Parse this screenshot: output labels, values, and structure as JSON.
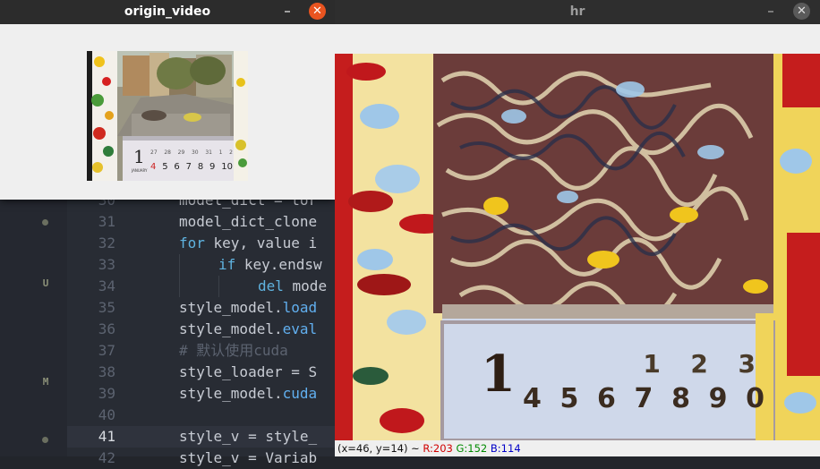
{
  "editor": {
    "lines": [
      {
        "num": "30",
        "code": "model_dict = tor"
      },
      {
        "num": "31",
        "code": "model_dict_clone"
      },
      {
        "num": "32",
        "code_kw": "for",
        "code_rest": " key, value i"
      },
      {
        "num": "33",
        "code_kw": "if",
        "code_rest": " key.endsw"
      },
      {
        "num": "34",
        "code_kw": "del",
        "code_rest": " mode"
      },
      {
        "num": "35",
        "code_pre": "style_model.",
        "code_fn": "load"
      },
      {
        "num": "36",
        "code_pre": "style_model.",
        "code_fn": "eval"
      },
      {
        "num": "37",
        "comment": "# 默认使用cuda"
      },
      {
        "num": "38",
        "code": "style_loader = S"
      },
      {
        "num": "39",
        "code_pre": "style_model.",
        "code_fn": "cuda"
      },
      {
        "num": "40",
        "code": ""
      },
      {
        "num": "41",
        "code": "style_v = style_"
      },
      {
        "num": "42",
        "code": "style_v = Variab"
      }
    ],
    "current_line": "41",
    "git_marks": [
      "U",
      "M"
    ]
  },
  "origin_window": {
    "title": "origin_video",
    "min_glyph": "–",
    "close_glyph": "✕",
    "calendar": {
      "month": "1",
      "month_name": "JANUARY",
      "row1": [
        "27",
        "28",
        "29",
        "30",
        "31",
        "1",
        "2"
      ],
      "row2": [
        "4",
        "5",
        "6",
        "7",
        "8",
        "9",
        "10"
      ]
    }
  },
  "hr_window": {
    "title": "hr",
    "min_glyph": "–",
    "close_glyph": "✕",
    "calendar": {
      "month": "1",
      "row1": [
        "",
        "",
        "",
        "",
        "1",
        "2",
        "3"
      ],
      "row2": [
        "4",
        "5",
        "6",
        "7",
        "8",
        "9",
        "0"
      ]
    },
    "status": {
      "coords": "(x=46, y=14) ~ ",
      "r": "R:203",
      "g": "G:152",
      "b": "B:114"
    }
  },
  "colors": {
    "close_active": "#e95420",
    "close_inactive": "#5a5a5a",
    "titlebar": "#2c2c2c"
  }
}
